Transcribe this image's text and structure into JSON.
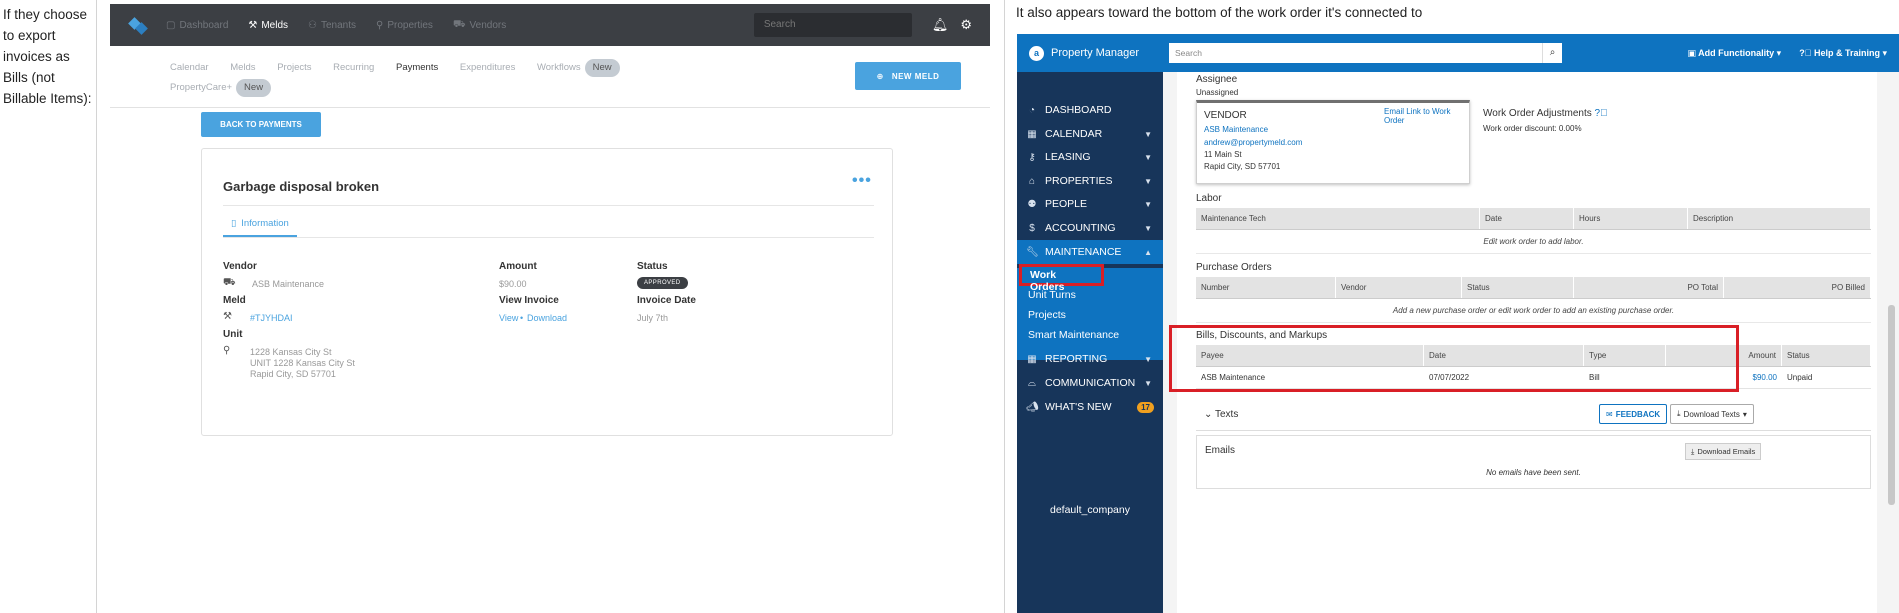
{
  "left_text": "If they choose to export invoices as Bills (not Billable Items):",
  "meld": {
    "nav": [
      {
        "label": "Dashboard",
        "icon": "calendar-icon"
      },
      {
        "label": "Melds",
        "icon": "tools-icon",
        "active": true
      },
      {
        "label": "Tenants",
        "icon": "person-icon"
      },
      {
        "label": "Properties",
        "icon": "pin-icon"
      },
      {
        "label": "Vendors",
        "icon": "truck-icon"
      }
    ],
    "search_placeholder": "Search",
    "subnav": [
      "Calendar",
      "Melds",
      "Projects",
      "Recurring",
      "Payments",
      "Expenditures",
      "Workflows"
    ],
    "subnav_active": "Payments",
    "new_pill": "New",
    "propertycare": "PropertyCare+",
    "new_meld_button": "NEW MELD",
    "back_button": "BACK TO PAYMENTS",
    "card_title": "Garbage disposal broken",
    "tab_info": "Information",
    "vendor_label": "Vendor",
    "vendor_value": "ASB Maintenance",
    "meld_label": "Meld",
    "meld_value": "#TJYHDAI",
    "unit_label": "Unit",
    "unit_line1": "1228 Kansas City St",
    "unit_line2": "UNIT 1228 Kansas City St",
    "unit_line3": "Rapid City, SD 57701",
    "amount_label": "Amount",
    "amount_value": "$90.00",
    "view_invoice_label": "View Invoice",
    "view_link": "View",
    "download_link": "Download",
    "status_label": "Status",
    "status_value": "APPROVED",
    "invoice_date_label": "Invoice Date",
    "invoice_date_value": "July 7th"
  },
  "right_caption": "It also appears toward the bottom of the work order it's connected to",
  "pm": {
    "brand": "Property Manager",
    "search_placeholder": "Search",
    "add_functionality": "Add Functionality",
    "help_training": "Help & Training",
    "sidebar": [
      {
        "label": "DASHBOARD",
        "icon": "dashboard-icon"
      },
      {
        "label": "CALENDAR",
        "icon": "calendar-icon"
      },
      {
        "label": "LEASING",
        "icon": "key-icon"
      },
      {
        "label": "PROPERTIES",
        "icon": "home-icon"
      },
      {
        "label": "PEOPLE",
        "icon": "people-icon"
      },
      {
        "label": "ACCOUNTING",
        "icon": "dollar-icon"
      },
      {
        "label": "MAINTENANCE",
        "icon": "wrench-icon"
      },
      {
        "label": "REPORTING",
        "icon": "table-icon"
      },
      {
        "label": "COMMUNICATION",
        "icon": "inbox-icon"
      },
      {
        "label": "WHAT'S NEW",
        "icon": "megaphone-icon"
      }
    ],
    "maintenance_sub": [
      "Work Orders",
      "Unit Turns",
      "Projects",
      "Smart Maintenance"
    ],
    "whats_new_count": "17",
    "company": "default_company",
    "assignee_label": "Assignee",
    "assignee_value": "Unassigned",
    "vendor_heading": "VENDOR",
    "email_link": "Email Link to Work Order",
    "vendor_name": "ASB Maintenance",
    "vendor_email": "andrew@propertymeld.com",
    "vendor_addr1": "11 Main St",
    "vendor_addr2": "Rapid City, SD 57701",
    "wo_adjustments": "Work Order Adjustments",
    "wo_discount": "Work order discount: 0.00%",
    "labor_heading": "Labor",
    "labor_cols": [
      "Maintenance Tech",
      "Date",
      "Hours",
      "Description"
    ],
    "labor_empty": "Edit work order to add labor.",
    "po_heading": "Purchase Orders",
    "po_cols": [
      "Number",
      "Vendor",
      "Status",
      "PO Total",
      "PO Billed"
    ],
    "po_empty": "Add a new purchase order or edit work order to add an existing purchase order.",
    "bills_heading": "Bills, Discounts, and Markups",
    "bills_cols": [
      "Payee",
      "Date",
      "Type",
      "Amount",
      "Status"
    ],
    "bills_row": {
      "payee": "ASB Maintenance",
      "date": "07/07/2022",
      "type": "Bill",
      "amount": "$90.00",
      "status": "Unpaid"
    },
    "texts_label": "Texts",
    "feedback_button": "FEEDBACK",
    "download_texts": "Download Texts",
    "emails_heading": "Emails",
    "download_emails": "Download Emails",
    "emails_empty": "No emails have been sent."
  }
}
